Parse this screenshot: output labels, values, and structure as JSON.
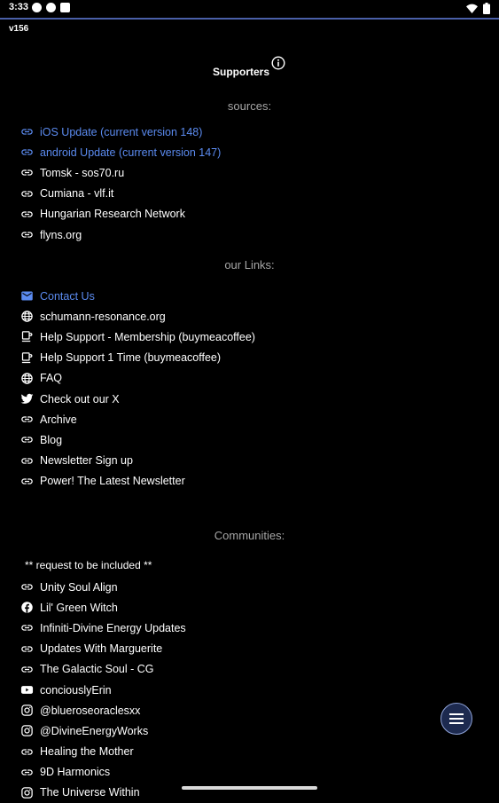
{
  "status_bar": {
    "time": "3:33"
  },
  "version": "v156",
  "header": {
    "title": "Supporters"
  },
  "colors": {
    "accent": "#5b8bf0",
    "section_header": "#a6a6a6",
    "divider": "#4a5fa8"
  },
  "sections": {
    "sources": {
      "title": "sources:",
      "items": [
        {
          "label": "iOS Update (current version 148)",
          "icon": "link-icon"
        },
        {
          "label": "android Update (current version 147)",
          "icon": "link-icon"
        },
        {
          "label": "Tomsk - sos70.ru",
          "icon": "link-icon"
        },
        {
          "label": "Cumiana - vlf.it",
          "icon": "link-icon"
        },
        {
          "label": "Hungarian Research Network",
          "icon": "link-icon"
        },
        {
          "label": "flyns.org",
          "icon": "link-icon"
        }
      ]
    },
    "links": {
      "title": "our Links:",
      "items": [
        {
          "label": "Contact Us",
          "icon": "mail-icon"
        },
        {
          "label": "schumann-resonance.org",
          "icon": "globe-icon"
        },
        {
          "label": "Help Support - Membership (buymeacoffee)",
          "icon": "coffee-icon"
        },
        {
          "label": "Help Support 1 Time (buymeacoffee)",
          "icon": "coffee-icon"
        },
        {
          "label": "FAQ",
          "icon": "globe-icon"
        },
        {
          "label": "Check out our X",
          "icon": "twitter-icon"
        },
        {
          "label": "Archive",
          "icon": "link-icon"
        },
        {
          "label": "Blog",
          "icon": "link-icon"
        },
        {
          "label": "Newsletter Sign up",
          "icon": "link-icon"
        },
        {
          "label": "Power! The Latest Newsletter",
          "icon": "link-icon"
        }
      ]
    },
    "communities": {
      "title": "Communities:",
      "note": "** request to be included **",
      "items": [
        {
          "label": "Unity Soul Align",
          "icon": "link-icon"
        },
        {
          "label": "Lil' Green Witch",
          "icon": "facebook-icon"
        },
        {
          "label": "Infiniti-Divine Energy Updates",
          "icon": "link-icon"
        },
        {
          "label": "Updates With Marguerite",
          "icon": "link-icon"
        },
        {
          "label": "The Galactic Soul - CG",
          "icon": "link-icon"
        },
        {
          "label": "conciouslyErin",
          "icon": "youtube-icon"
        },
        {
          "label": "@blueroseoraclesxx",
          "icon": "instagram-icon"
        },
        {
          "label": "@DivineEnergyWorks",
          "icon": "instagram-icon"
        },
        {
          "label": "Healing the Mother",
          "icon": "link-icon"
        },
        {
          "label": "9D Harmonics",
          "icon": "link-icon"
        },
        {
          "label": "The Universe Within",
          "icon": "instagram-icon"
        }
      ]
    }
  }
}
